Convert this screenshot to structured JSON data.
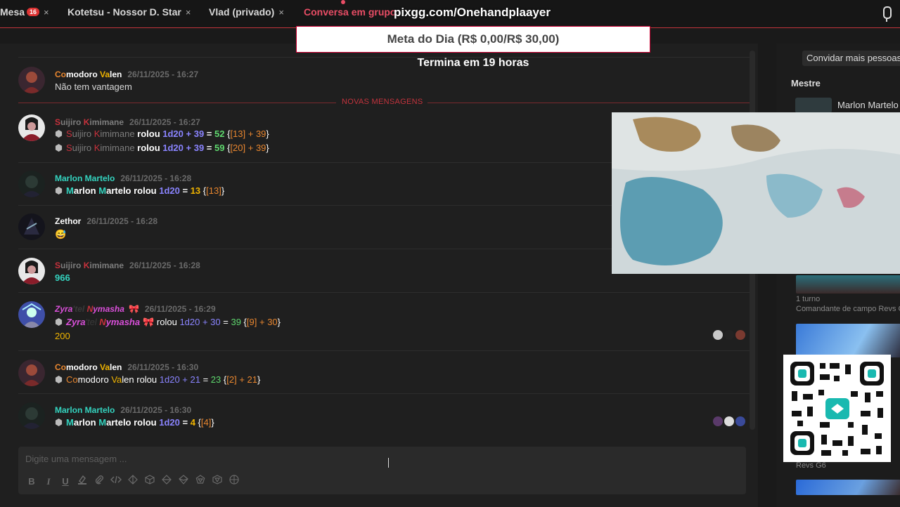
{
  "tabs": [
    {
      "label": "Mesa",
      "badge": "16",
      "close": "×"
    },
    {
      "label": "Kotetsu - Nossor D. Star",
      "close": "×"
    },
    {
      "label": "Vlad (privado)",
      "close": "×"
    },
    {
      "label": "Conversa em grupo",
      "close": ""
    }
  ],
  "overlay": {
    "url": "pixgg.com/Onehandplaayer",
    "goal": "Meta do Dia (R$ 0,00/R$ 30,00)",
    "goal_sub": "Termina em 19 horas"
  },
  "new_messages_label": "NOVAS MENSAGENS",
  "messages": [
    {
      "user_a": "Co",
      "user_b": "modoro ",
      "user_c": "Va",
      "user_d": "len",
      "time": "26/11/2025 - 16:27",
      "text": "Não tem vantagem"
    },
    {
      "user_a": "S",
      "user_b": "uijiro ",
      "user_c": "K",
      "user_d": "imimane",
      "time": "26/11/2025 - 16:27",
      "roll1": {
        "who_a": "S",
        "who_b": "uijiro ",
        "who_c": "K",
        "who_d": "imimane",
        "verb": " rolou ",
        "dice": "1d20 + 39",
        "eq": " = ",
        "result": "52",
        "detail_open": " {",
        "detail_a": "[13]",
        "detail_b": " + 39",
        "detail_close": "}"
      },
      "roll2": {
        "who_a": "S",
        "who_b": "uijiro ",
        "who_c": "K",
        "who_d": "imimane",
        "verb": " rolou ",
        "dice": "1d20 + 39",
        "eq": " = ",
        "result": "59",
        "detail_open": " {",
        "detail_a": "[20]",
        "detail_b": " + 39",
        "detail_close": "}"
      }
    },
    {
      "user_a": "Marlon ",
      "user_b": "Martelo",
      "time": "26/11/2025 - 16:28",
      "roll": {
        "who_a": "M",
        "who_b": "arlon ",
        "who_c": "M",
        "who_d": "artelo",
        "verb": " rolou ",
        "dice": "1d20",
        "eq": " = ",
        "result": "13",
        "detail_open": " {",
        "detail_a": "[13]",
        "detail_close": "}"
      }
    },
    {
      "user_a": "Zethor",
      "time": "26/11/2025 - 16:28",
      "text": "😅"
    },
    {
      "user_a": "S",
      "user_b": "uijiro ",
      "user_c": "K",
      "user_d": "imimane",
      "time": "26/11/2025 - 16:28",
      "text": "966"
    },
    {
      "user_a": "Zyra",
      "user_b": "'tel ",
      "user_c": "N",
      "user_d": "ymasha",
      "badge": "🎀",
      "time": "26/11/2025 - 16:29",
      "roll": {
        "who_a": "Zyra",
        "who_b": "'tel ",
        "who_c": "N",
        "who_d": "ymasha",
        "badge": "🎀",
        "verb": " rolou ",
        "dice": "1d20 + 30",
        "eq": " = ",
        "result": "39",
        "detail_open": " {",
        "detail_a": "[9]",
        "detail_b": " + 30",
        "detail_close": "}"
      },
      "text": "200"
    },
    {
      "user_a": "Co",
      "user_b": "modoro ",
      "user_c": "Va",
      "user_d": "len",
      "time": "26/11/2025 - 16:30",
      "roll": {
        "who_a": "Co",
        "who_b": "modoro ",
        "who_c": "Va",
        "who_d": "len",
        "verb": " rolou ",
        "dice": "1d20 + 21",
        "eq": " = ",
        "result": "23",
        "detail_open": " {",
        "detail_a": "[2]",
        "detail_b": " + 21",
        "detail_close": "}"
      }
    },
    {
      "user_a": "Marlon ",
      "user_b": "Martelo",
      "time": "26/11/2025 - 16:30",
      "roll": {
        "who_a": "M",
        "who_b": "arlon ",
        "who_c": "M",
        "who_d": "artelo",
        "verb": " rolou ",
        "dice": "1d20",
        "eq": " = ",
        "result": "4",
        "detail_open": " {",
        "detail_a": "[4]",
        "detail_close": "}"
      }
    }
  ],
  "input": {
    "placeholder": "Digite uma mensagem ..."
  },
  "toolbar": [
    "B",
    "I",
    "U"
  ],
  "sidebar": {
    "invite": "Convidar mais pessoas",
    "section": "Mestre",
    "master": "Marlon Martelo",
    "turn": "1 turno",
    "campaign": "Comandante de campo Revs G",
    "bottom_label": "Revs G6"
  },
  "colors": {
    "accent": "#e84d65",
    "border": "#c0343b"
  }
}
